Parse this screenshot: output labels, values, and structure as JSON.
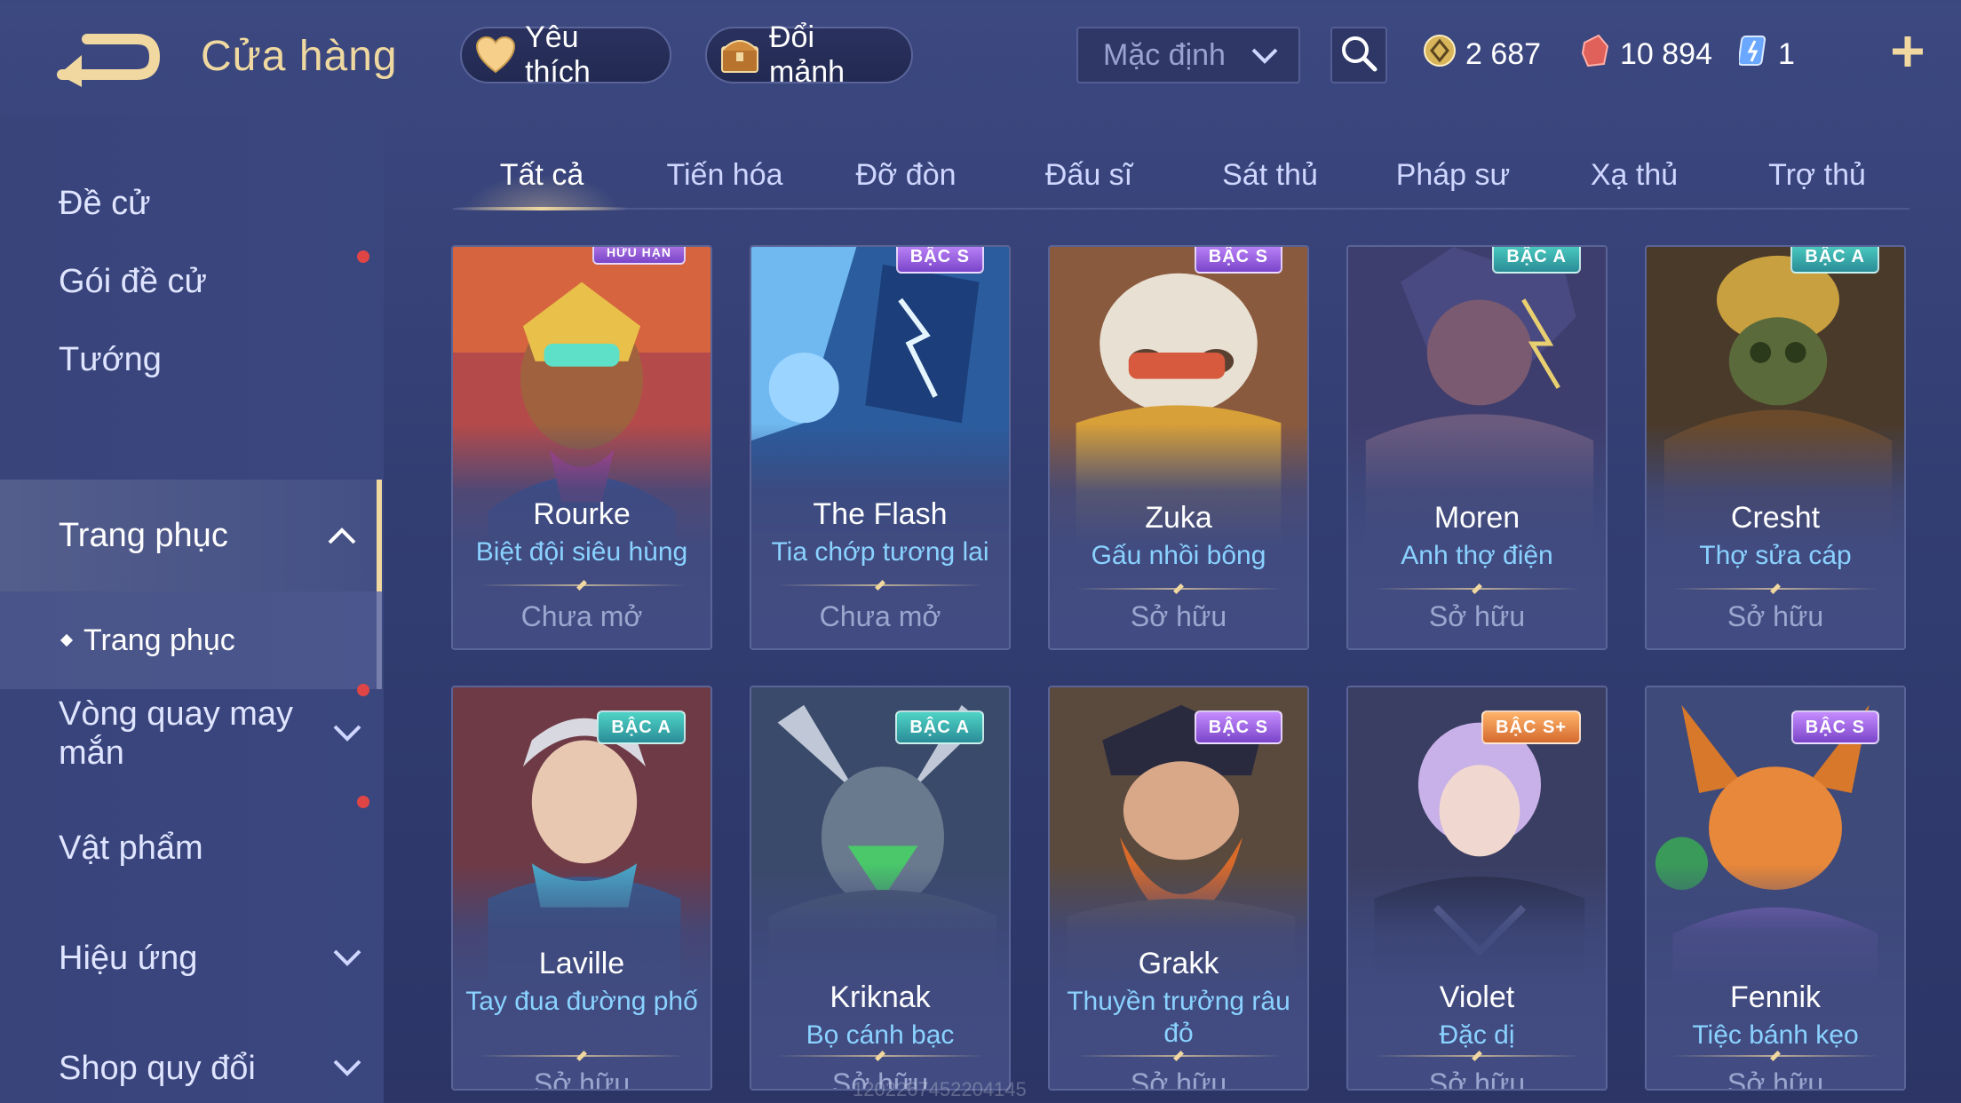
{
  "header": {
    "title": "Cửa hàng",
    "favorite_label": "Yêu thích",
    "exchange_label": "Đổi mảnh",
    "sort_value": "Mặc định",
    "currencies": [
      {
        "name": "gold-coin",
        "value": "2 687"
      },
      {
        "name": "voucher",
        "value": "10 894"
      },
      {
        "name": "gem",
        "value": "1"
      }
    ]
  },
  "sidebar": {
    "items": [
      {
        "label": "Đề cử",
        "dot": false
      },
      {
        "label": "Gói đề cử",
        "dot": true
      },
      {
        "label": "Tướng",
        "dot": false
      },
      {
        "label": "Trang phục",
        "dot": false,
        "expanded": true
      },
      {
        "label": "Vòng quay may mắn",
        "dot": true
      },
      {
        "label": "Vật phẩm",
        "dot": true
      },
      {
        "label": "Hiệu ứng",
        "dot": false
      },
      {
        "label": "Shop quy đổi",
        "dot": false
      }
    ],
    "sub_item": "Trang phục"
  },
  "tabs": [
    "Tất cả",
    "Tiến hóa",
    "Đỡ đòn",
    "Đấu sĩ",
    "Sát thủ",
    "Pháp sư",
    "Xạ thủ",
    "Trợ thủ"
  ],
  "active_tab": 0,
  "skins": [
    {
      "hero": "Rourke",
      "skin": "Biệt đội siêu hùng",
      "status": "Chưa mở",
      "badge": "HỮU HẠN",
      "badge_type": "limited"
    },
    {
      "hero": "The Flash",
      "skin": "Tia chớp tương lai",
      "status": "Chưa mở",
      "badge": "BẬC S",
      "badge_type": "bac-s"
    },
    {
      "hero": "Zuka",
      "skin": "Gấu nhồi bông",
      "status": "Sở hữu",
      "badge": "BẬC S",
      "badge_type": "bac-s"
    },
    {
      "hero": "Moren",
      "skin": "Anh thợ điện",
      "status": "Sở hữu",
      "badge": "BẬC A",
      "badge_type": "bac-a"
    },
    {
      "hero": "Cresht",
      "skin": "Thợ sửa cáp",
      "status": "Sở hữu",
      "badge": "BẬC A",
      "badge_type": "bac-a"
    },
    {
      "hero": "Laville",
      "skin": "Tay đua đường phố",
      "status": "Sở hữu",
      "badge": "BẬC A",
      "badge_type": "bac-a"
    },
    {
      "hero": "Kriknak",
      "skin": "Bọ cánh bạc",
      "status": "Sở hữu",
      "badge": "BẬC A",
      "badge_type": "bac-a"
    },
    {
      "hero": "Grakk",
      "skin": "Thuyền trưởng râu đỏ",
      "status": "Sở hữu",
      "badge": "BẬC S",
      "badge_type": "bac-s"
    },
    {
      "hero": "Violet",
      "skin": "Đặc dị",
      "status": "Sở hữu",
      "badge": "BẬC S+",
      "badge_type": "bac-sp"
    },
    {
      "hero": "Fennik",
      "skin": "Tiệc bánh kẹo",
      "status": "Sở hữu",
      "badge": "BẬC S",
      "badge_type": "bac-s"
    }
  ],
  "watermark": "1202267452204145",
  "colors": {
    "accent_gold": "#f1d8a0",
    "skin_name": "#8ad2ff",
    "status_text": "#9da6cf",
    "notify_dot": "#e04545"
  }
}
